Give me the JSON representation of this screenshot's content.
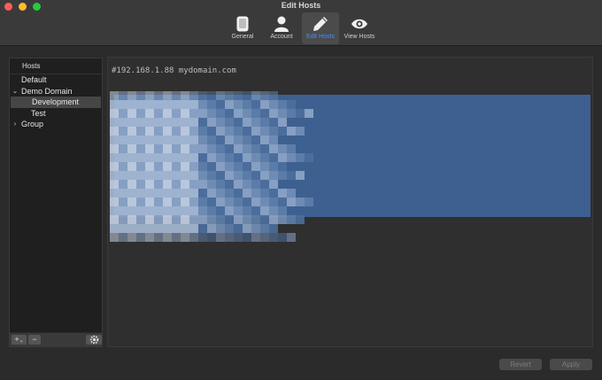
{
  "window": {
    "title": "Edit Hosts"
  },
  "toolbar": {
    "items": [
      {
        "label": "General",
        "icon": "phone-icon"
      },
      {
        "label": "Account",
        "icon": "person-icon"
      },
      {
        "label": "Edit Hosts",
        "icon": "pencil-icon",
        "active": true
      },
      {
        "label": "View Hosts",
        "icon": "eye-icon"
      }
    ]
  },
  "sidebar": {
    "header": "Hosts",
    "items": [
      {
        "label": "Default"
      },
      {
        "label": "Demo Domain",
        "expanded": true
      },
      {
        "label": "Development",
        "selected": true
      },
      {
        "label": "Test"
      },
      {
        "label": "Group",
        "expanded": false
      }
    ],
    "footer": {
      "add": "+",
      "remove": "−",
      "gear": "gear-icon"
    }
  },
  "editor": {
    "lines": [
      "#192.168.1.88 mydomain.com"
    ]
  },
  "buttons": {
    "revert": "Revert",
    "apply": "Apply"
  },
  "colors": {
    "accent": "#3e91ff",
    "selection": "#3d6090"
  }
}
